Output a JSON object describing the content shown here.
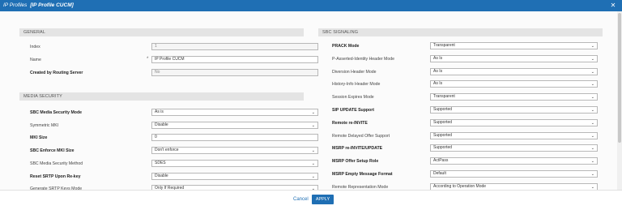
{
  "window": {
    "title": "IP Profiles",
    "subtitle": "[IP Profile CUCM]",
    "close_glyph": "✕"
  },
  "general": {
    "header": "GENERAL",
    "rows": [
      {
        "label": "Index",
        "value": "1",
        "required": false,
        "bold": false,
        "kind": "readonly"
      },
      {
        "label": "Name",
        "value": "IP Profile CUCM",
        "required": true,
        "bold": false,
        "kind": "input"
      },
      {
        "label": "Created by Routing Server",
        "value": "No",
        "required": false,
        "bold": true,
        "kind": "readonly"
      }
    ]
  },
  "media_security": {
    "header": "MEDIA SECURITY",
    "rows": [
      {
        "label": "SBC Media Security Mode",
        "value": "As is",
        "bold": true,
        "kind": "select"
      },
      {
        "label": "Symmetric MKI",
        "value": "Disable",
        "bold": false,
        "kind": "select"
      },
      {
        "label": "MKI Size",
        "value": "0",
        "bold": true,
        "kind": "input"
      },
      {
        "label": "SBC Enforce MKI Size",
        "value": "Don't enforce",
        "bold": true,
        "kind": "select"
      },
      {
        "label": "SBC Media Security Method",
        "value": "SDES",
        "bold": false,
        "kind": "select"
      },
      {
        "label": "Reset SRTP Upon Re-key",
        "value": "Disable",
        "bold": true,
        "kind": "select"
      },
      {
        "label": "Generate SRTP Keys Mode",
        "value": "Only If Required",
        "bold": false,
        "kind": "select"
      }
    ]
  },
  "sbc_signaling": {
    "header": "SBC SIGNALING",
    "rows": [
      {
        "label": "PRACK Mode",
        "value": "Transparent",
        "bold": true,
        "kind": "select"
      },
      {
        "label": "P-Asserted-Identity Header Mode",
        "value": "As Is",
        "bold": false,
        "kind": "select"
      },
      {
        "label": "Diversion Header Mode",
        "value": "As Is",
        "bold": false,
        "kind": "select"
      },
      {
        "label": "History-Info Header Mode",
        "value": "As Is",
        "bold": false,
        "kind": "select"
      },
      {
        "label": "Session Expires Mode",
        "value": "Transparent",
        "bold": false,
        "kind": "select"
      },
      {
        "label": "SIP UPDATE Support",
        "value": "Supported",
        "bold": true,
        "kind": "select"
      },
      {
        "label": "Remote re-INVITE",
        "value": "Supported",
        "bold": true,
        "kind": "select"
      },
      {
        "label": "Remote Delayed Offer Support",
        "value": "Supported",
        "bold": false,
        "kind": "select"
      },
      {
        "label": "MSRP re-INVITE/UPDATE",
        "value": "Supported",
        "bold": true,
        "kind": "select"
      },
      {
        "label": "MSRP Offer Setup Role",
        "value": "ActPass",
        "bold": true,
        "kind": "select"
      },
      {
        "label": "MSRP Empty Message Format",
        "value": "Default",
        "bold": true,
        "kind": "select"
      },
      {
        "label": "Remote Representation Mode",
        "value": "According to Operation Mode",
        "bold": false,
        "kind": "select"
      }
    ]
  },
  "footer": {
    "cancel_label": "Cancel",
    "apply_label": "APPLY"
  },
  "colors": {
    "accent": "#1f6fb4",
    "section_header_bg": "#e4e4e4"
  },
  "icons": {
    "required_marker": "*",
    "dropdown": "chevron-down-icon"
  }
}
